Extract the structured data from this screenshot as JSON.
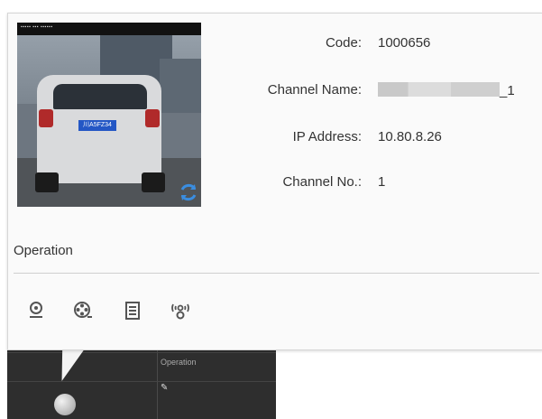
{
  "background": {
    "operation_label": "Operation",
    "pencil_glyph": "✎"
  },
  "popup": {
    "snapshot": {
      "plate_text": "川A5FZ34"
    },
    "rows": [
      {
        "label": "Code:",
        "value": "1000656"
      },
      {
        "label": "Channel Name:",
        "value": "_1"
      },
      {
        "label": "IP Address:",
        "value": "10.80.8.26"
      },
      {
        "label": "Channel No.:",
        "value": "1"
      }
    ],
    "operation": {
      "title": "Operation",
      "icons": [
        "live-view-icon",
        "playback-icon",
        "log-icon",
        "alarm-output-icon"
      ]
    }
  },
  "colors": {
    "refresh_blue": "#3a8de0",
    "icon_gray": "#555555"
  }
}
